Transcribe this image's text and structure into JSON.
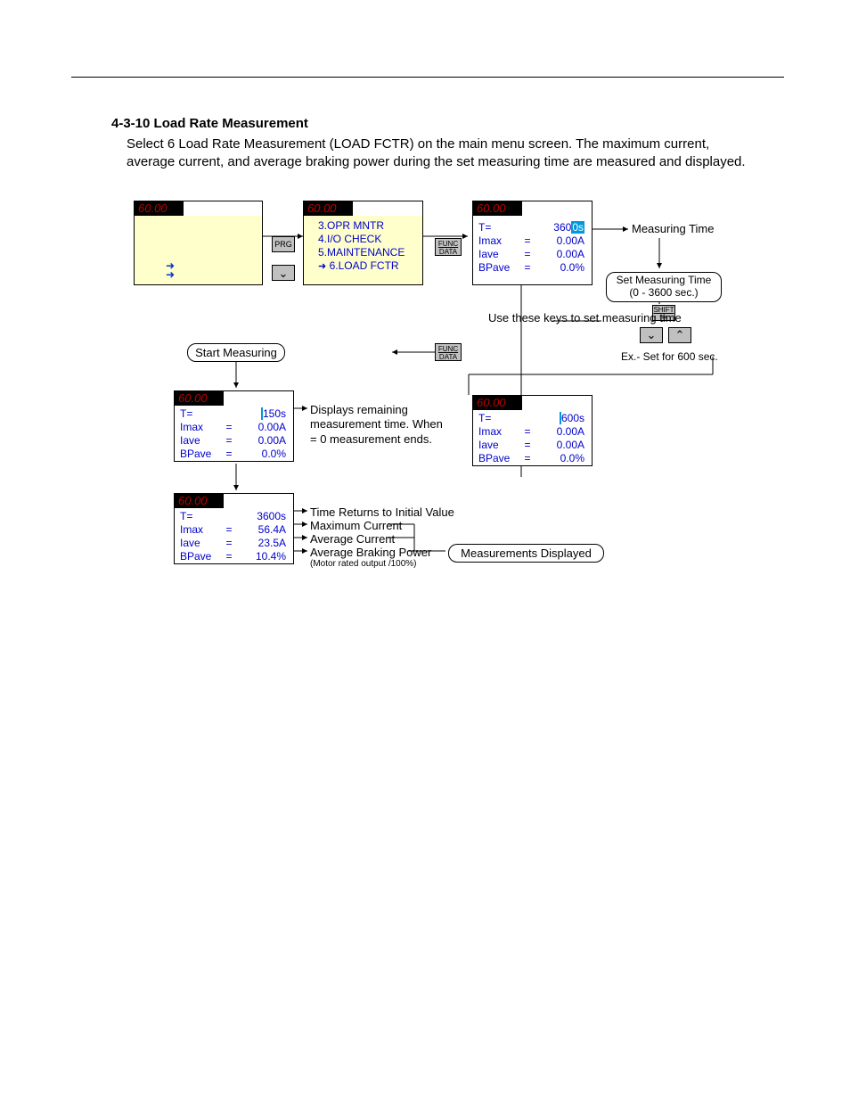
{
  "section": {
    "number": "4-3-10",
    "title": "Load Rate Measurement",
    "description": "Select 6 Load Rate Measurement (LOAD FCTR) on the main menu screen. The maximum current, average current, and average braking power during the set measuring time are measured and displayed."
  },
  "common": {
    "led": "60.00"
  },
  "menu": {
    "items": [
      "3.OPR MNTR",
      "4.I/O CHECK",
      "5.MAINTENANCE",
      "6.LOAD FCTR"
    ]
  },
  "keys": {
    "prg": "PRG",
    "func1": "FUNC",
    "func2": "DATA",
    "shift": "SHIFT"
  },
  "rows": {
    "t": "T=",
    "imax": "Imax",
    "iave": "Iave",
    "bpave": "BPave"
  },
  "panels": {
    "p3": {
      "t": "360",
      "thl": "0s",
      "imax": "0.00A",
      "iave": "0.00A",
      "bpave": "0.0%"
    },
    "p4": {
      "thl": " ",
      "t": "600s",
      "imax": "0.00A",
      "iave": "0.00A",
      "bpave": "0.0%"
    },
    "p5": {
      "thl": " ",
      "t": "150s",
      "imax": "0.00A",
      "iave": "0.00A",
      "bpave": "0.0%"
    },
    "p6": {
      "t": "3600s",
      "imax": "56.4A",
      "iave": "23.5A",
      "bpave": "10.4%"
    }
  },
  "labels": {
    "measuring_time": "Measuring Time",
    "set_time": "Set Measuring Time (0 - 3600 sec.)",
    "example": "Ex.- Set for 600 sec.",
    "use_keys": "Use these keys to set measuring time",
    "start": "Start Measuring",
    "remaining": "Displays remaining measurement time. When = 0 measurement ends.",
    "time_returns": "Time Returns to Initial Value",
    "max_current": "Maximum Current",
    "avg_current": "Average Current",
    "avg_braking": "Average Braking Power",
    "motor_rated": "(Motor rated output /100%)",
    "meas_displayed": "Measurements Displayed"
  }
}
